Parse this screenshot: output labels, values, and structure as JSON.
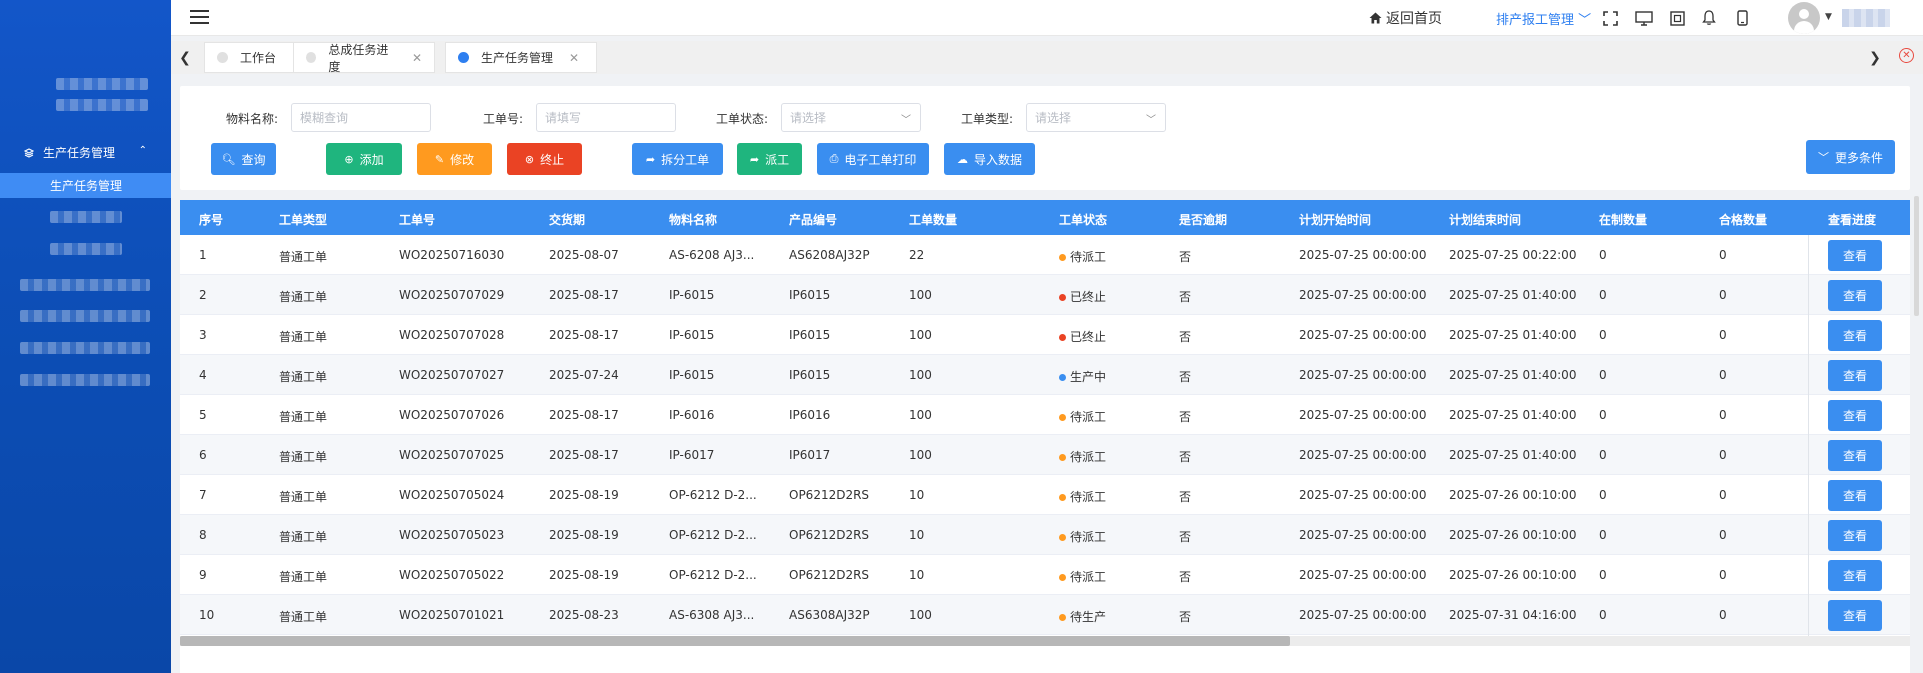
{
  "sidebar": {
    "parent_menu": "生产任务管理",
    "active_item": "生产任务管理"
  },
  "header": {
    "home_link": "返回首页",
    "scheduling_menu": "排产报工管理"
  },
  "tabs": [
    {
      "label": "工作台",
      "active": false,
      "closable": false
    },
    {
      "label": "总成任务进度",
      "active": false,
      "closable": true
    },
    {
      "label": "生产任务管理",
      "active": true,
      "closable": true
    }
  ],
  "filters": {
    "material_label": "物料名称:",
    "material_placeholder": "模糊查询",
    "workorder_label": "工单号:",
    "workorder_placeholder": "请填写",
    "status_label": "工单状态:",
    "status_placeholder": "请选择",
    "type_label": "工单类型:",
    "type_placeholder": "请选择"
  },
  "buttons": {
    "query": "查询",
    "add": "添加",
    "edit": "修改",
    "terminate": "终止",
    "split": "拆分工单",
    "dispatch": "派工",
    "print": "电子工单打印",
    "import": "导入数据",
    "more": "更多条件"
  },
  "table": {
    "columns": [
      "序号",
      "工单类型",
      "工单号",
      "交货期",
      "物料名称",
      "产品编号",
      "工单数量",
      "工单状态",
      "是否逾期",
      "计划开始时间",
      "计划结束时间",
      "在制数量",
      "合格数量",
      "查看进度"
    ],
    "view_label": "查看",
    "status_colors": {
      "待派工": "#ff9a1f",
      "已终止": "#ea4324",
      "生产中": "#3a8ef0",
      "待生产": "#ff9a1f"
    },
    "rows": [
      {
        "no": "1",
        "type": "普通工单",
        "wo": "WO20250716030",
        "due": "2025-08-07",
        "material": "AS-6208 AJ3...",
        "product": "AS6208AJ32P",
        "qty": "22",
        "status": "待派工",
        "overdue": "否",
        "start": "2025-07-25 00:00:00",
        "end": "2025-07-25 00:22:00",
        "wip": "0",
        "passed": "0"
      },
      {
        "no": "2",
        "type": "普通工单",
        "wo": "WO20250707029",
        "due": "2025-08-17",
        "material": "IP-6015",
        "product": "IP6015",
        "qty": "100",
        "status": "已终止",
        "overdue": "否",
        "start": "2025-07-25 00:00:00",
        "end": "2025-07-25 01:40:00",
        "wip": "0",
        "passed": "0"
      },
      {
        "no": "3",
        "type": "普通工单",
        "wo": "WO20250707028",
        "due": "2025-08-17",
        "material": "IP-6015",
        "product": "IP6015",
        "qty": "100",
        "status": "已终止",
        "overdue": "否",
        "start": "2025-07-25 00:00:00",
        "end": "2025-07-25 01:40:00",
        "wip": "0",
        "passed": "0"
      },
      {
        "no": "4",
        "type": "普通工单",
        "wo": "WO20250707027",
        "due": "2025-07-24",
        "material": "IP-6015",
        "product": "IP6015",
        "qty": "100",
        "status": "生产中",
        "overdue": "否",
        "start": "2025-07-25 00:00:00",
        "end": "2025-07-25 01:40:00",
        "wip": "0",
        "passed": "0"
      },
      {
        "no": "5",
        "type": "普通工单",
        "wo": "WO20250707026",
        "due": "2025-08-17",
        "material": "IP-6016",
        "product": "IP6016",
        "qty": "100",
        "status": "待派工",
        "overdue": "否",
        "start": "2025-07-25 00:00:00",
        "end": "2025-07-25 01:40:00",
        "wip": "0",
        "passed": "0"
      },
      {
        "no": "6",
        "type": "普通工单",
        "wo": "WO20250707025",
        "due": "2025-08-17",
        "material": "IP-6017",
        "product": "IP6017",
        "qty": "100",
        "status": "待派工",
        "overdue": "否",
        "start": "2025-07-25 00:00:00",
        "end": "2025-07-25 01:40:00",
        "wip": "0",
        "passed": "0"
      },
      {
        "no": "7",
        "type": "普通工单",
        "wo": "WO20250705024",
        "due": "2025-08-19",
        "material": "OP-6212 D-2...",
        "product": "OP6212D2RS",
        "qty": "10",
        "status": "待派工",
        "overdue": "否",
        "start": "2025-07-25 00:00:00",
        "end": "2025-07-26 00:10:00",
        "wip": "0",
        "passed": "0"
      },
      {
        "no": "8",
        "type": "普通工单",
        "wo": "WO20250705023",
        "due": "2025-08-19",
        "material": "OP-6212 D-2...",
        "product": "OP6212D2RS",
        "qty": "10",
        "status": "待派工",
        "overdue": "否",
        "start": "2025-07-25 00:00:00",
        "end": "2025-07-26 00:10:00",
        "wip": "0",
        "passed": "0"
      },
      {
        "no": "9",
        "type": "普通工单",
        "wo": "WO20250705022",
        "due": "2025-08-19",
        "material": "OP-6212 D-2...",
        "product": "OP6212D2RS",
        "qty": "10",
        "status": "待派工",
        "overdue": "否",
        "start": "2025-07-25 00:00:00",
        "end": "2025-07-26 00:10:00",
        "wip": "0",
        "passed": "0"
      },
      {
        "no": "10",
        "type": "普通工单",
        "wo": "WO20250701021",
        "due": "2025-08-23",
        "material": "AS-6308 AJ3...",
        "product": "AS6308AJ32P",
        "qty": "100",
        "status": "待生产",
        "overdue": "否",
        "start": "2025-07-25 00:00:00",
        "end": "2025-07-31 04:16:00",
        "wip": "0",
        "passed": "0"
      }
    ]
  }
}
